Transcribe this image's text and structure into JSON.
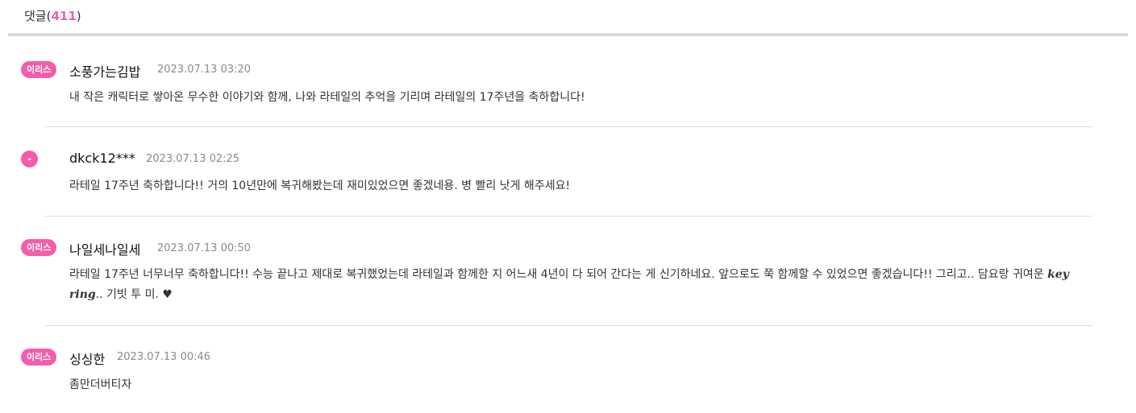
{
  "header": {
    "label": "댓글",
    "open_paren": "(",
    "count": "411",
    "close_paren": ")"
  },
  "colors": {
    "accent": "#f45dab",
    "divider": "#dcdcdc"
  },
  "comments": [
    {
      "badge": "이리스",
      "author": "소풍가는김밥",
      "date": "2023.07.13 03:20",
      "text": "내 작은 캐릭터로 쌓아온 무수한 이야기와 함께, 나와 라테일의 추억을 기리며 라테일의 17주년을 축하합니다!"
    },
    {
      "badge": "-",
      "author": "dkck12***",
      "date": "2023.07.13 02:25",
      "text": "라테일 17주년 축하합니다!! 거의 10년만에 복귀해봤는데 재미있었으면 좋겠네용. 병 빨리 낫게 해주세요!"
    },
    {
      "badge": "이리스",
      "author": "나일세나일세",
      "date": "2023.07.13 00:50",
      "text_before": "라테일 17주년 너무너무 축하합니다!! 수능 끝나고 제대로 복귀했었는데 라테일과 함께한 지 어느새 4년이 다 되어 간다는 게 신기하네요. 앞으로도 쭉 함께할 수 있었으면 좋겠습니다!! 그리고.. 담요랑 귀여운 ",
      "text_script": "key ring",
      "text_after": ".. 기빗 투 미. ♥"
    },
    {
      "badge": "이리스",
      "author": "싱싱한",
      "date": "2023.07.13 00:46",
      "text": "좀만더버티자"
    }
  ]
}
